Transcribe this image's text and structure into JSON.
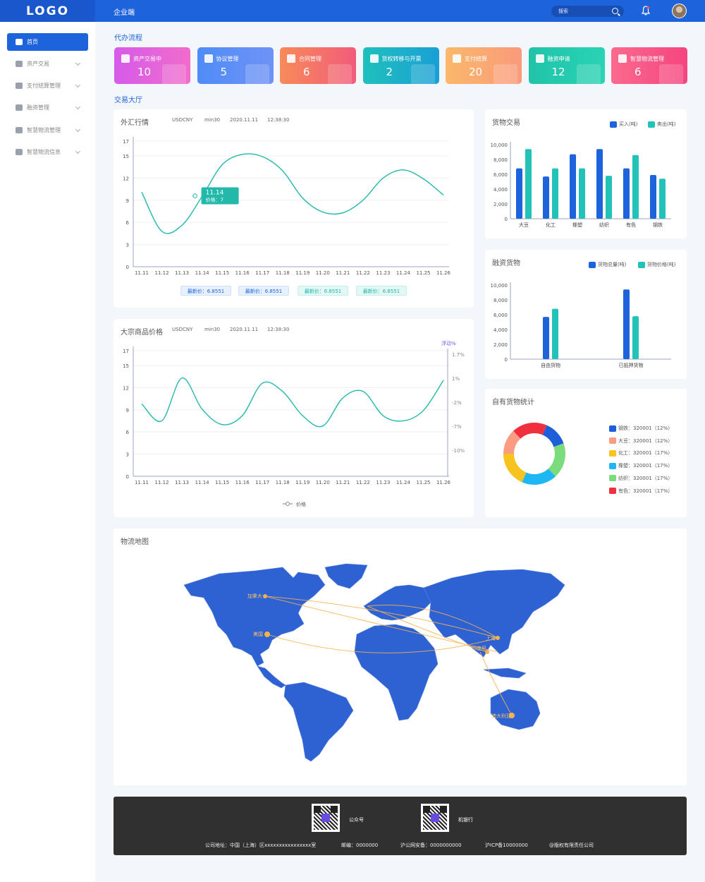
{
  "header": {
    "logo": "LOGO",
    "title": "企业端",
    "search_placeholder": "搜索"
  },
  "sidebar": {
    "items": [
      {
        "label": "首页",
        "icon": "home-icon",
        "active": true
      },
      {
        "label": "资产交易",
        "icon": "wallet-icon"
      },
      {
        "label": "支付结算管理",
        "icon": "shield-icon"
      },
      {
        "label": "融资管理",
        "icon": "hand-coin-icon"
      },
      {
        "label": "智慧物流管理",
        "icon": "boxes-icon"
      },
      {
        "label": "智慧物流信息",
        "icon": "truck-icon"
      }
    ]
  },
  "sections": {
    "todo": "代办流程",
    "hall": "交易大厅"
  },
  "cards": [
    {
      "label": "资产交易中",
      "value": "10",
      "color1": "#d55bea",
      "color2": "#f26ccb"
    },
    {
      "label": "协议管理",
      "value": "5",
      "color1": "#4f8cf7",
      "color2": "#6f93f6"
    },
    {
      "label": "合同管理",
      "value": "6",
      "color1": "#f78a5a",
      "color2": "#f25c7a"
    },
    {
      "label": "货权转移与开票",
      "value": "2",
      "color1": "#1fc0bd",
      "color2": "#1a9fd6"
    },
    {
      "label": "支付结算",
      "value": "20",
      "color1": "#fbb86a",
      "color2": "#fa9a7c"
    },
    {
      "label": "融资申请",
      "value": "12",
      "color1": "#21c3a8",
      "color2": "#2ad3b4"
    },
    {
      "label": "智慧物流管理",
      "value": "6",
      "color1": "#fb6a8e",
      "color2": "#f5457f"
    }
  ],
  "forex": {
    "title": "外汇行情",
    "pair": "USDCNY",
    "interval": "min30",
    "date": "2020.11.11",
    "time": "12:38:30",
    "tooltip_value": "11.14",
    "tooltip_label": "价格：7",
    "pills": [
      "最新价：6.8551",
      "最新价：6.8551",
      "最新价：6.8551",
      "最新价：6.8551"
    ]
  },
  "commodity": {
    "title": "大宗商品价格",
    "pair": "USDCNY",
    "interval": "min30",
    "date": "2020.11.11",
    "time": "12:38:30",
    "right_axis_title": "浮动%",
    "legend": "价格",
    "right_ticks": [
      "1.7%",
      "1%",
      "-2%",
      "-7%",
      "-10%"
    ]
  },
  "goods_trade": {
    "title": "货物交易",
    "legend": [
      "买入(吨)",
      "卖出(吨)"
    ]
  },
  "finance_goods": {
    "title": "融资货物",
    "legend": [
      "货物总量(吨)",
      "货物价格(吨)"
    ]
  },
  "own_goods": {
    "title": "自有货物统计",
    "legend": [
      "钢铁：320001（12%）",
      "大豆：320001（12%）",
      "化工：320001（17%）",
      "橡塑：320001（17%）",
      "纺织：320001（17%）",
      "有色：320001（17%）"
    ]
  },
  "map": {
    "title": "物流地图",
    "labels": [
      "加拿大",
      "美国",
      "上海",
      "印度尼",
      "澳大利亚"
    ]
  },
  "footer": {
    "qr1": "公众号",
    "qr2": "机银行",
    "address": "公司地址：中国（上海）区xxxxxxxxxxxxxxxx室",
    "postcode": "邮编：0000000",
    "security": "沪公网安备：0000000000",
    "icp": "沪ICP备10000000",
    "copyright": "@版权有限责任公司"
  },
  "chart_data": [
    {
      "type": "line",
      "title": "外汇行情",
      "categories": [
        "11.11",
        "11.12",
        "11.13",
        "11.14",
        "11.15",
        "11.16",
        "11.17",
        "11.18",
        "11.19",
        "11.20",
        "11.21",
        "11.22",
        "11.23",
        "11.24",
        "11.25",
        "11.26"
      ],
      "series": [
        {
          "values": [
            10.1,
            4.8,
            5.6,
            9.5,
            13.8,
            15.2,
            14.9,
            13.0,
            9.3,
            7.4,
            7.3,
            9.0,
            12.0,
            13.1,
            11.9,
            9.7
          ]
        }
      ],
      "ylim": [
        0,
        17
      ],
      "yticks": [
        0,
        3,
        6,
        9,
        12,
        15,
        17
      ]
    },
    {
      "type": "line",
      "title": "大宗商品价格",
      "categories": [
        "11.11",
        "11.12",
        "11.13",
        "11.14",
        "11.15",
        "11.16",
        "11.17",
        "11.18",
        "11.19",
        "11.20",
        "11.21",
        "11.22",
        "11.23",
        "11.24",
        "11.25",
        "11.26"
      ],
      "series": [
        {
          "name": "价格",
          "values": [
            9.8,
            7.5,
            13.3,
            9.1,
            7.0,
            8.2,
            12.6,
            11.5,
            8.2,
            6.8,
            10.6,
            11.5,
            8.2,
            7.5,
            8.9,
            13.0
          ]
        }
      ],
      "ylim": [
        0,
        17
      ],
      "yticks": [
        0,
        3,
        6,
        9,
        12,
        15,
        17
      ]
    },
    {
      "type": "bar",
      "title": "货物交易",
      "categories": [
        "大豆",
        "化工",
        "橡塑",
        "纺织",
        "有色",
        "钢铁"
      ],
      "series": [
        {
          "name": "买入(吨)",
          "values": [
            6800,
            5700,
            8700,
            9400,
            6800,
            5900
          ]
        },
        {
          "name": "卖出(吨)",
          "values": [
            9400,
            6800,
            6800,
            5800,
            8600,
            5400
          ]
        }
      ],
      "ylim": [
        0,
        10000
      ]
    },
    {
      "type": "bar",
      "title": "融资货物",
      "categories": [
        "自由货物",
        "已抵押货物"
      ],
      "series": [
        {
          "name": "货物总量(吨)",
          "values": [
            5700,
            9400
          ]
        },
        {
          "name": "货物价格(吨)",
          "values": [
            6800,
            5800
          ]
        }
      ],
      "ylim": [
        0,
        10000
      ]
    },
    {
      "type": "pie",
      "title": "自有货物统计",
      "categories": [
        "钢铁",
        "大豆",
        "化工",
        "橡塑",
        "纺织",
        "有色"
      ],
      "values": [
        12,
        12,
        17,
        17,
        17,
        17
      ],
      "colors": [
        "#1d5fdb",
        "#fb9b82",
        "#f7c31e",
        "#1fb6f4",
        "#7bdc7b",
        "#f0303c"
      ]
    }
  ]
}
